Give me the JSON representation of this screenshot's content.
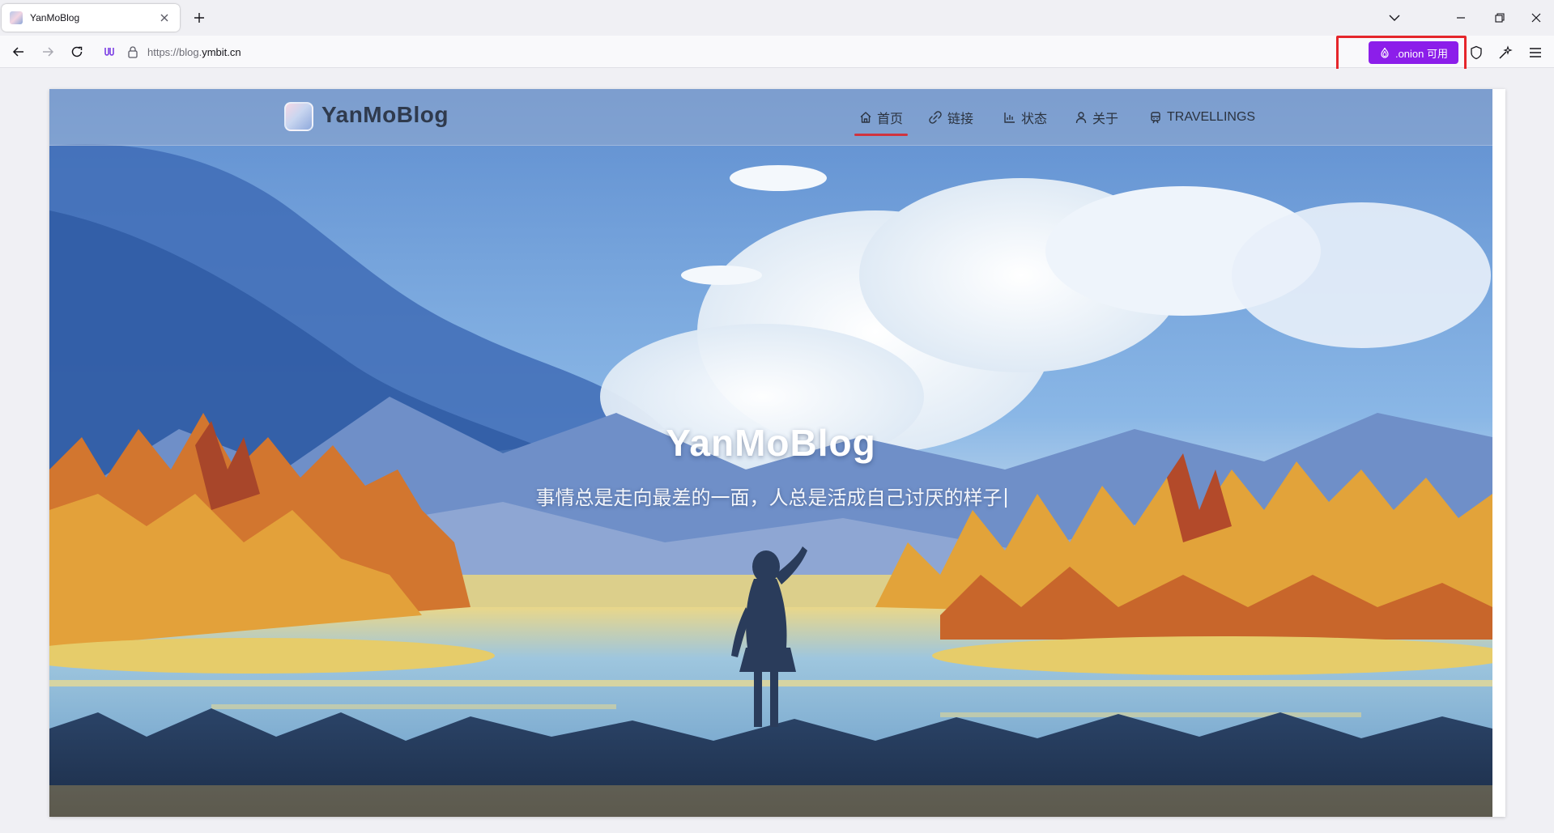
{
  "browser": {
    "tab": {
      "title": "YanMoBlog"
    },
    "url": {
      "scheme": "https://blog.",
      "host": "ymbit.cn"
    },
    "onion_button": {
      "label": ".onion 可用"
    }
  },
  "site": {
    "name": "YanMoBlog",
    "nav": [
      {
        "label": "首页",
        "icon": "home-icon",
        "active": true
      },
      {
        "label": "链接",
        "icon": "link-icon",
        "active": false
      },
      {
        "label": "状态",
        "icon": "chart-icon",
        "active": false
      },
      {
        "label": "关于",
        "icon": "user-icon",
        "active": false
      },
      {
        "label": "TRAVELLINGS",
        "icon": "train-icon",
        "active": false
      }
    ],
    "hero": {
      "title": "YanMoBlog",
      "subtitle": "事情总是走向最差的一面，人总是活成自己讨厌的样子"
    }
  },
  "colors": {
    "onion_purple": "#8c1eea",
    "highlight_red": "#e5262b",
    "nav_active_underline": "#d0343f"
  }
}
